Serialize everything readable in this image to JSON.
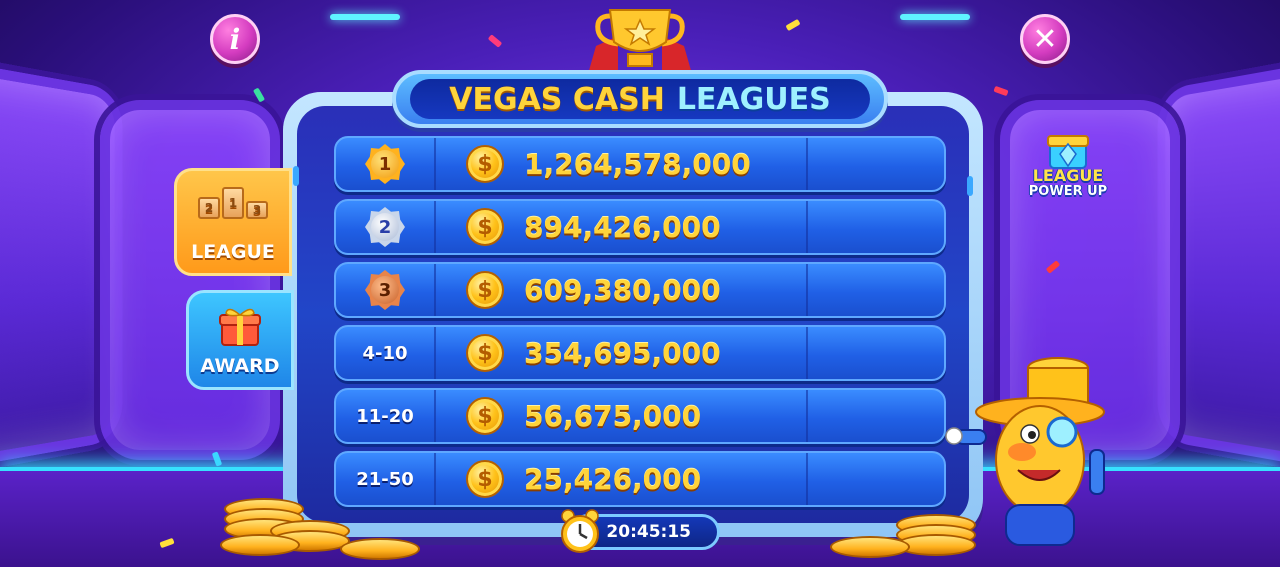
{
  "title": {
    "part1": "VEGAS CASH",
    "part2": "LEAGUES"
  },
  "buttons": {
    "info_glyph": "i",
    "close_glyph": "✕"
  },
  "tabs": {
    "league": {
      "label": "LEAGUE",
      "podium": [
        "2",
        "1",
        "3"
      ]
    },
    "award": {
      "label": "AWARD"
    }
  },
  "rows": [
    {
      "rank": "1",
      "badge": "gold",
      "amount": "1,264,578,000"
    },
    {
      "rank": "2",
      "badge": "silver",
      "amount": "894,426,000"
    },
    {
      "rank": "3",
      "badge": "bronze",
      "amount": "609,380,000"
    },
    {
      "rank": "4-10",
      "badge": "",
      "amount": "354,695,000"
    },
    {
      "rank": "11-20",
      "badge": "",
      "amount": "56,675,000"
    },
    {
      "rank": "21-50",
      "badge": "",
      "amount": "25,426,000"
    }
  ],
  "coin_glyph": "$",
  "timer": {
    "value": "20:45:15"
  },
  "powerup": {
    "line1": "LEAGUE",
    "line2": "POWER UP"
  },
  "colors": {
    "accent_gold": "#ffd43b",
    "panel_blue": "#2146c8",
    "league_tab": "#ff9a1a",
    "award_tab": "#1f86e8"
  }
}
